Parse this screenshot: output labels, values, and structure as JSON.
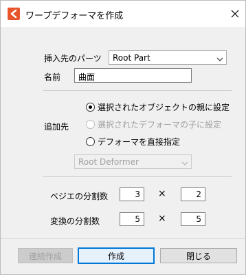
{
  "window": {
    "title": "ワープデフォーマを作成",
    "close_glyph": "✕",
    "brand_color": "#e8552a"
  },
  "form": {
    "insert_target": {
      "label": "挿入先のパーツ",
      "value": "Root Part"
    },
    "name": {
      "label": "名前",
      "value": "曲面"
    },
    "add_to": {
      "label": "追加先",
      "options": [
        {
          "label": "選択されたオブジェクトの親に設定",
          "checked": true,
          "disabled": false
        },
        {
          "label": "選択されたデフォーマの子に設定",
          "checked": false,
          "disabled": true
        },
        {
          "label": "デフォーマを直接指定",
          "checked": false,
          "disabled": false
        }
      ],
      "deformer_select": "Root Deformer"
    },
    "bezier_divisions": {
      "label": "ベジエの分割数",
      "x": "3",
      "y": "2",
      "times": "×"
    },
    "transform_divisions": {
      "label": "変換の分割数",
      "x": "5",
      "y": "5",
      "times": "×"
    }
  },
  "buttons": {
    "continuous": "連続作成",
    "create": "作成",
    "close": "閉じる"
  }
}
